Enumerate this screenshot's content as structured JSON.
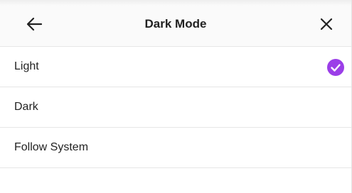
{
  "header": {
    "title": "Dark Mode"
  },
  "options": [
    {
      "label": "Light",
      "selected": true
    },
    {
      "label": "Dark",
      "selected": false
    },
    {
      "label": "Follow System",
      "selected": false
    }
  ],
  "colors": {
    "accent": "#9b3ee8",
    "divider": "#e6e6e6",
    "text": "#222222"
  },
  "icons": {
    "back": "arrow-left-icon",
    "close": "close-icon",
    "selected": "check-circle-icon"
  }
}
